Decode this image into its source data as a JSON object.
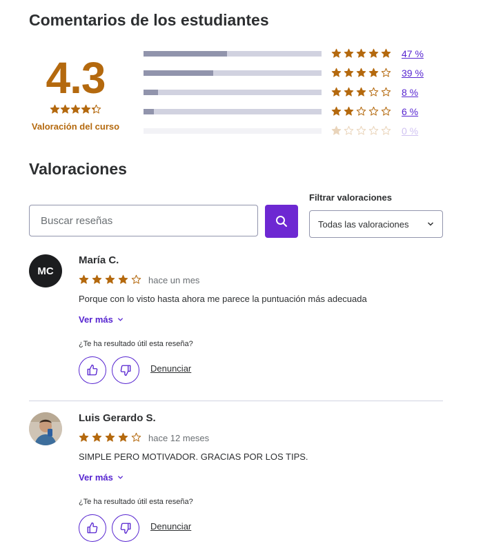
{
  "feedback": {
    "title": "Comentarios de los estudiantes",
    "rating": "4.3",
    "rating_stars": 4.3,
    "rating_label": "Valoración del curso",
    "distribution": [
      {
        "stars": 5,
        "percent_label": "47 %",
        "fill": 0.47
      },
      {
        "stars": 4,
        "percent_label": "39 %",
        "fill": 0.39
      },
      {
        "stars": 3,
        "percent_label": "8 %",
        "fill": 0.08
      },
      {
        "stars": 2,
        "percent_label": "6 %",
        "fill": 0.06
      },
      {
        "stars": 1,
        "percent_label": "0 %",
        "fill": 0.0
      }
    ]
  },
  "reviews_section": {
    "title": "Valoraciones",
    "search_placeholder": "Buscar reseñas",
    "filter_label": "Filtrar valoraciones",
    "filter_value": "Todas las valoraciones"
  },
  "reviews": [
    {
      "initials": "MC",
      "name": "María C.",
      "stars": 4,
      "time": "hace un mes",
      "text": "Porque con lo visto hasta ahora me parece la puntuación más adecuada",
      "more_label": "Ver más",
      "helpful_label": "¿Te ha resultado útil esta reseña?",
      "report_label": "Denunciar"
    },
    {
      "initials": "",
      "name": "Luis Gerardo S.",
      "stars": 4,
      "time": "hace 12 meses",
      "text": "SIMPLE PERO MOTIVADOR. GRACIAS POR LOS TIPS.",
      "more_label": "Ver más",
      "helpful_label": "¿Te ha resultado útil esta reseña?",
      "report_label": "Denunciar"
    }
  ],
  "colors": {
    "star": "#b4690e",
    "accent": "#6d28d2",
    "link": "#5624d0"
  }
}
